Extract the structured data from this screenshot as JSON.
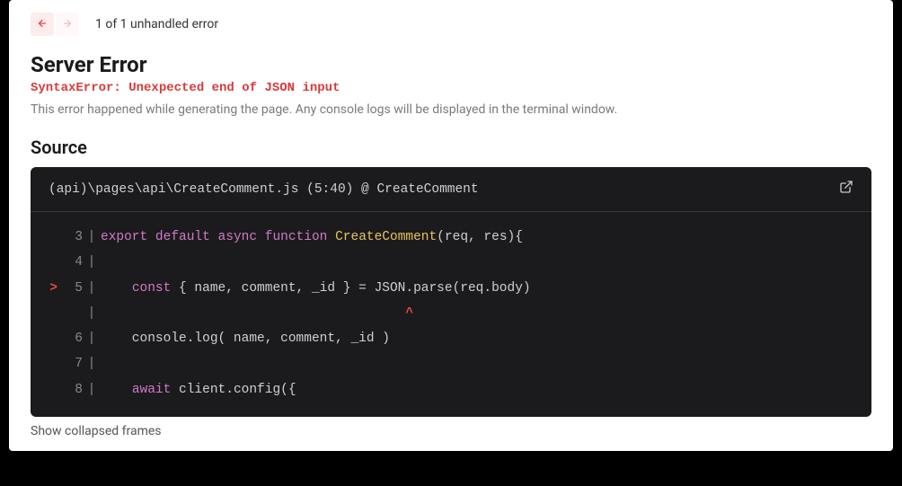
{
  "nav": {
    "counter": "1 of 1 unhandled error"
  },
  "header": {
    "title": "Server Error",
    "error_message": "SyntaxError: Unexpected end of JSON input",
    "description": "This error happened while generating the page. Any console logs will be displayed in the terminal window."
  },
  "source": {
    "title": "Source",
    "file_location": "(api)\\pages\\api\\CreateComment.js (5:40) @ CreateComment"
  },
  "code": {
    "lines": [
      {
        "num": "3",
        "caret": "",
        "segments": [
          {
            "t": "export ",
            "c": "kw"
          },
          {
            "t": "default ",
            "c": "kw"
          },
          {
            "t": "async ",
            "c": "kw"
          },
          {
            "t": "function ",
            "c": "kw2"
          },
          {
            "t": "CreateComment",
            "c": "fn"
          },
          {
            "t": "(req, res){",
            "c": "punc"
          }
        ]
      },
      {
        "num": "4",
        "caret": "",
        "segments": []
      },
      {
        "num": "5",
        "caret": ">",
        "segments": [
          {
            "t": "    ",
            "c": "var"
          },
          {
            "t": "const",
            "c": "kw"
          },
          {
            "t": " { name, comment, _id } = JSON.parse(req.body)",
            "c": "var"
          }
        ]
      },
      {
        "num": "",
        "caret": "",
        "segments": [
          {
            "t": "                                       ",
            "c": "var"
          },
          {
            "t": "^",
            "c": "caret-mark"
          }
        ]
      },
      {
        "num": "6",
        "caret": "",
        "segments": [
          {
            "t": "    console.log( name, comment, _id )",
            "c": "var"
          }
        ]
      },
      {
        "num": "7",
        "caret": "",
        "segments": []
      },
      {
        "num": "8",
        "caret": "",
        "segments": [
          {
            "t": "    ",
            "c": "var"
          },
          {
            "t": "await",
            "c": "kw"
          },
          {
            "t": " client.config({",
            "c": "var"
          }
        ]
      }
    ]
  },
  "footer": {
    "show_frames": "Show collapsed frames"
  }
}
